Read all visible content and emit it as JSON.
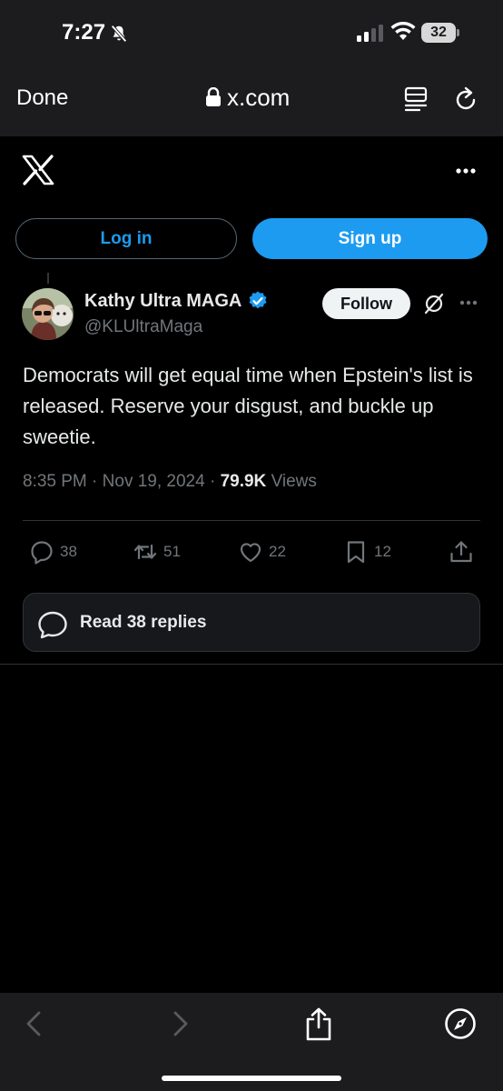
{
  "status_bar": {
    "time": "7:27",
    "battery": "32",
    "icons": [
      "bell-slash-icon",
      "signal-icon",
      "wifi-icon",
      "battery-icon"
    ]
  },
  "browser": {
    "done_label": "Done",
    "url": "x.com",
    "icons": [
      "lock-icon",
      "reader-mode-icon",
      "reload-icon"
    ]
  },
  "header": {
    "logo": "x-logo",
    "more_icon": "more-horizontal-icon"
  },
  "auth": {
    "login_label": "Log in",
    "signup_label": "Sign up"
  },
  "post": {
    "author_name": "Kathy Ultra MAGA",
    "handle": "@KLUltraMaga",
    "follow_label": "Follow",
    "text": "Democrats will get equal time when Epstein's list is released. Reserve your disgust, and buckle up sweetie.",
    "time": "8:35 PM",
    "separator": "·",
    "date": "Nov 19, 2024",
    "views_count": "79.9K",
    "views_label": "Views",
    "actions": {
      "replies": "38",
      "reposts": "51",
      "likes": "22",
      "bookmarks": "12"
    },
    "read_replies_label": "Read 38 replies"
  },
  "colors": {
    "accent": "#1d9bf0",
    "background": "#000000",
    "chrome": "#1c1c1e",
    "muted_text": "#71767b",
    "border": "#2f3336"
  },
  "toolbar": {
    "icons": [
      "back-icon",
      "forward-icon",
      "share-icon",
      "compass-icon"
    ]
  }
}
